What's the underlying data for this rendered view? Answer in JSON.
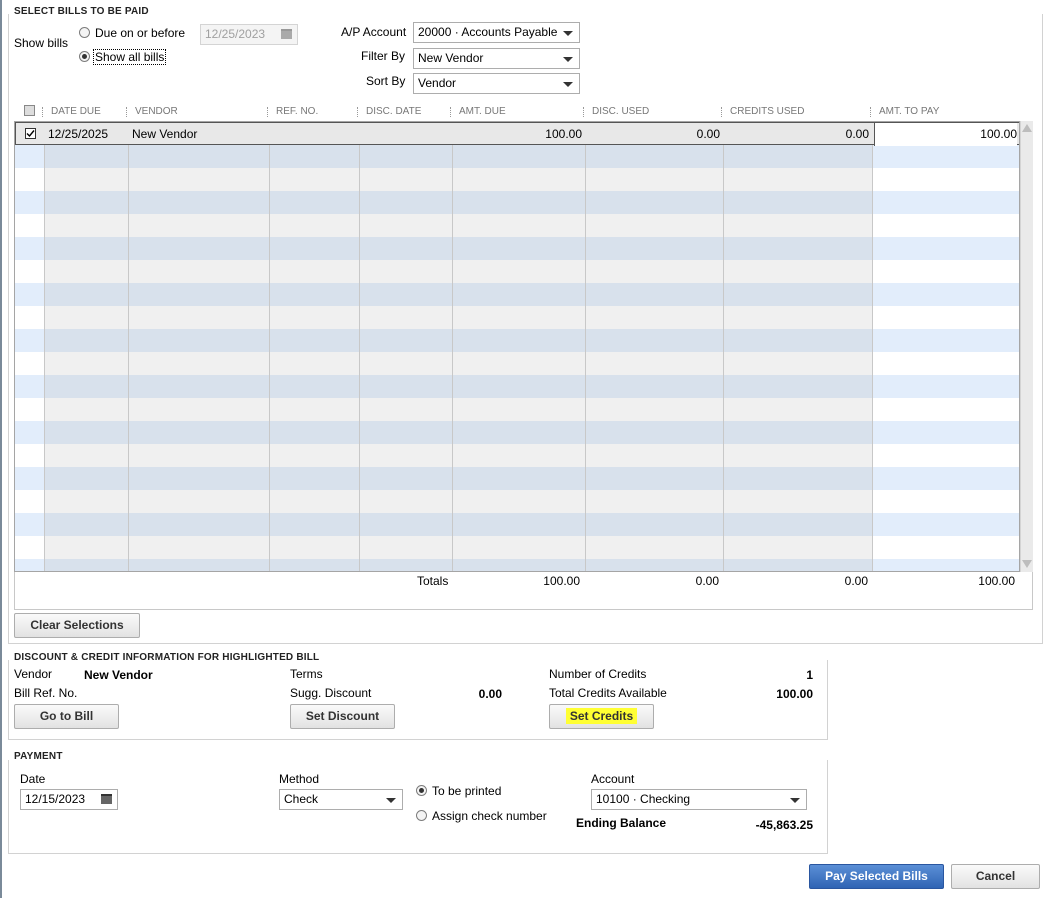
{
  "select_bills": {
    "section_title": "SELECT BILLS TO BE PAID",
    "show_bills_label": "Show bills",
    "due_on_or_before_label": "Due on or before",
    "due_date_value": "12/25/2023",
    "show_all_bills_label": "Show all bills",
    "selected_option": "show_all",
    "ap_account_label": "A/P Account",
    "ap_account_value": "20000 · Accounts Payable",
    "filter_by_label": "Filter By",
    "filter_by_value": "New Vendor",
    "sort_by_label": "Sort By",
    "sort_by_value": "Vendor"
  },
  "table": {
    "headers": {
      "date_due": "DATE DUE",
      "vendor": "VENDOR",
      "ref_no": "REF. NO.",
      "disc_date": "DISC. DATE",
      "amt_due": "AMT. DUE",
      "disc_used": "DISC. USED",
      "credits_used": "CREDITS USED",
      "amt_to_pay": "AMT. TO PAY"
    },
    "rows": [
      {
        "checked": true,
        "date_due": "12/25/2025",
        "vendor": "New Vendor",
        "ref_no": "",
        "disc_date": "",
        "amt_due": "100.00",
        "disc_used": "0.00",
        "credits_used": "0.00",
        "amt_to_pay": "100.00"
      }
    ],
    "totals": {
      "label": "Totals",
      "amt_due": "100.00",
      "disc_used": "0.00",
      "credits_used": "0.00",
      "amt_to_pay": "100.00"
    }
  },
  "clear_selections_label": "Clear Selections",
  "discount_credit": {
    "section_title": "DISCOUNT & CREDIT INFORMATION FOR HIGHLIGHTED BILL",
    "vendor_label": "Vendor",
    "vendor_value": "New Vendor",
    "bill_ref_label": "Bill Ref. No.",
    "terms_label": "Terms",
    "sugg_discount_label": "Sugg. Discount",
    "sugg_discount_value": "0.00",
    "number_of_credits_label": "Number of Credits",
    "number_of_credits_value": "1",
    "total_credits_label": "Total Credits Available",
    "total_credits_value": "100.00",
    "go_to_bill_label": "Go to Bill",
    "set_discount_label": "Set Discount",
    "set_credits_label": "Set Credits"
  },
  "payment": {
    "section_title": "PAYMENT",
    "date_label": "Date",
    "date_value": "12/15/2023",
    "method_label": "Method",
    "method_value": "Check",
    "to_be_printed_label": "To be printed",
    "assign_check_label": "Assign check number",
    "selected_option": "to_be_printed",
    "account_label": "Account",
    "account_value": "10100 · Checking",
    "ending_balance_label": "Ending Balance",
    "ending_balance_value": "-45,863.25"
  },
  "footer": {
    "pay_selected_label": "Pay Selected Bills",
    "cancel_label": "Cancel"
  },
  "colors": {
    "row_blue": "#e2edfb",
    "primary_button": "#2f64b4",
    "highlight": "#ffff33"
  }
}
